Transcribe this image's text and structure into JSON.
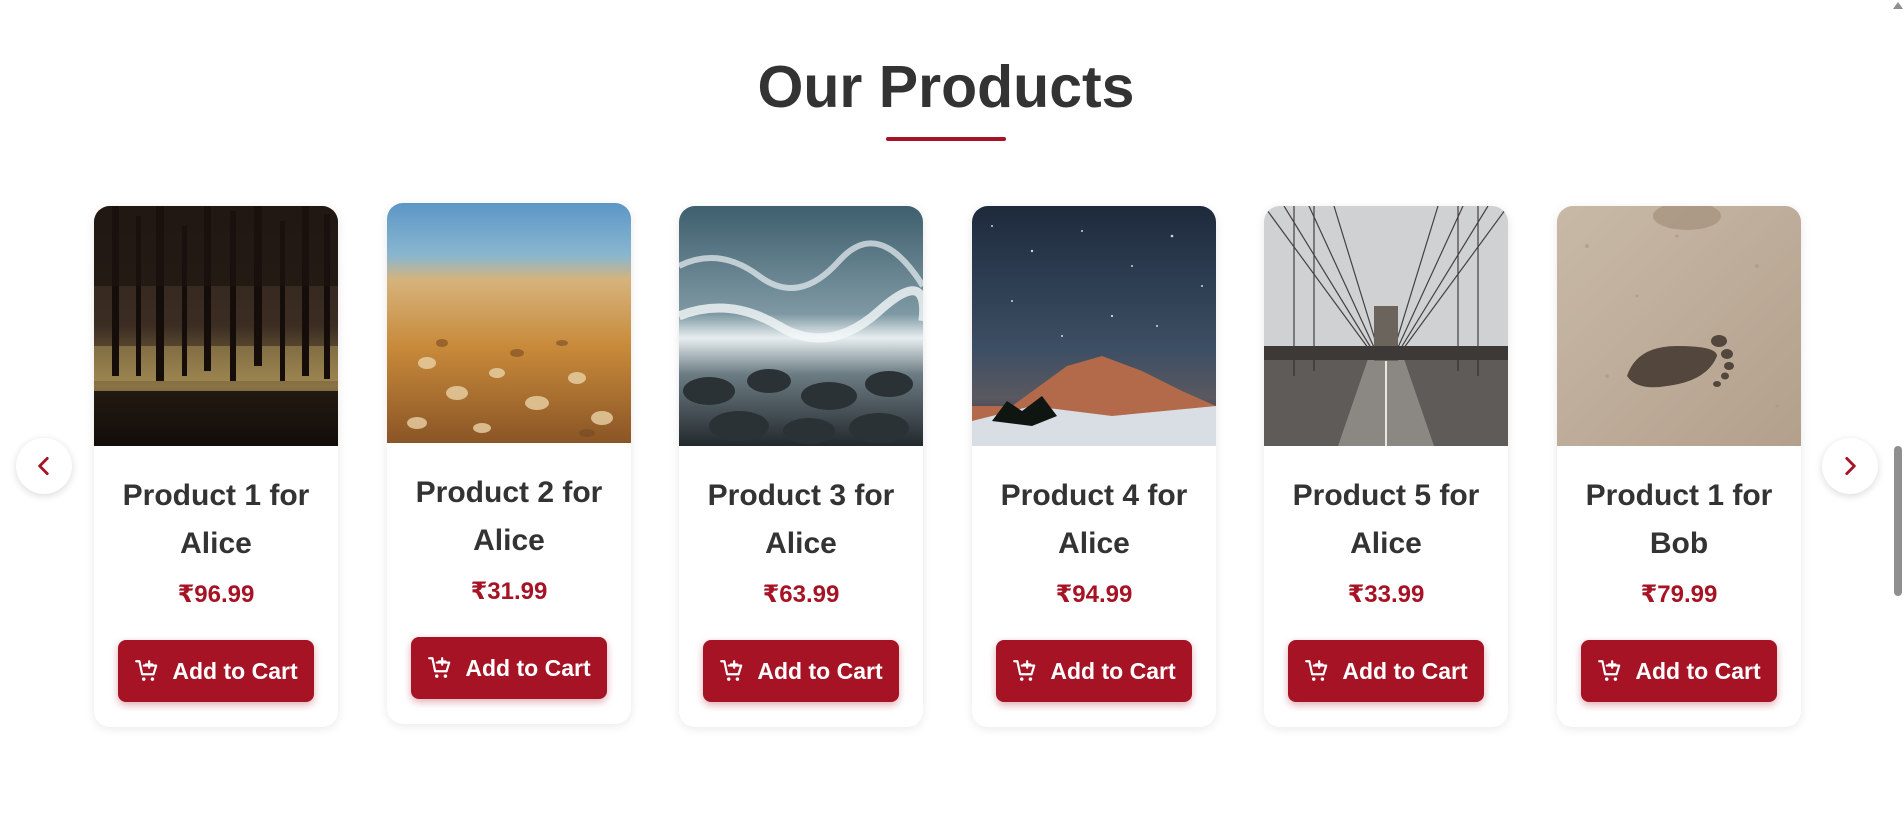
{
  "section": {
    "title": "Our Products"
  },
  "colors": {
    "accent": "#a51324",
    "text": "#333333",
    "background": "#ffffff"
  },
  "carousel": {
    "prev_icon": "chevron-left-icon",
    "next_icon": "chevron-right-icon",
    "cart_icon": "cart-plus-icon",
    "products": [
      {
        "name": "Product 1 for Alice",
        "price": "₹96.99",
        "button_label": "Add to Cart",
        "image": "dark forest trees"
      },
      {
        "name": "Product 2 for Alice",
        "price": "₹31.99",
        "button_label": "Add to Cart",
        "image": "seashells on beach"
      },
      {
        "name": "Product 3 for Alice",
        "price": "₹63.99",
        "button_label": "Add to Cart",
        "image": "waves on rocky shore"
      },
      {
        "name": "Product 4 for Alice",
        "price": "₹94.99",
        "button_label": "Add to Cart",
        "image": "starry night sky over mountain"
      },
      {
        "name": "Product 5 for Alice",
        "price": "₹33.99",
        "button_label": "Add to Cart",
        "image": "suspension bridge walkway"
      },
      {
        "name": "Product 1 for Bob",
        "price": "₹79.99",
        "button_label": "Add to Cart",
        "image": "footprint in sand"
      }
    ]
  }
}
